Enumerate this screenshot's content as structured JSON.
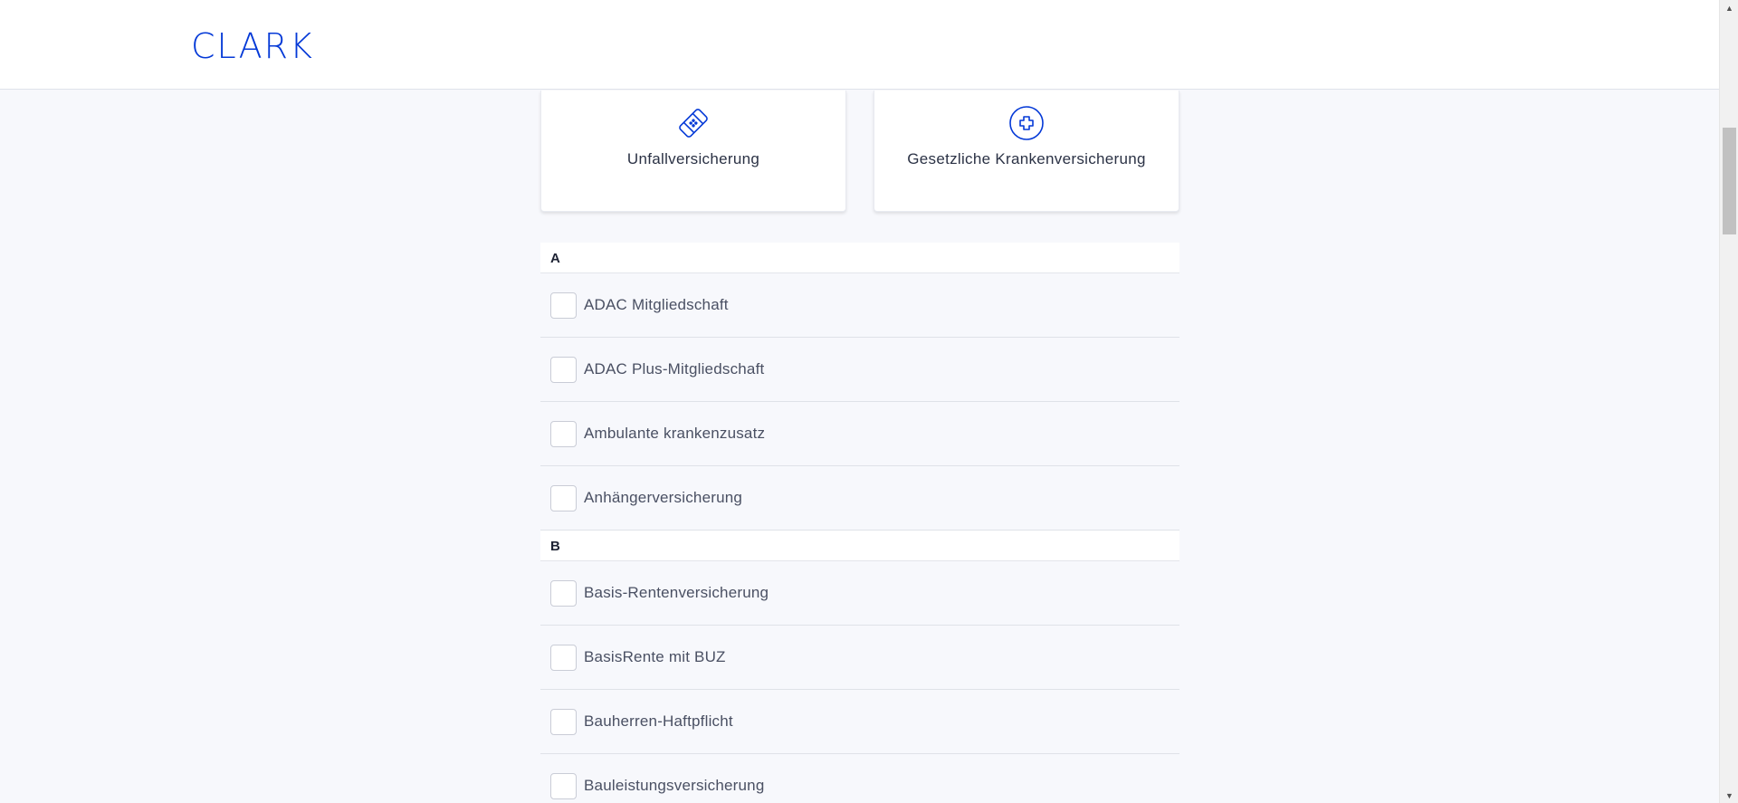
{
  "header": {
    "logo_text": "CLARK",
    "logo_color": "#0439d7"
  },
  "cards": [
    {
      "label": "Unfallversicherung",
      "icon": "bandage-icon"
    },
    {
      "label": "Gesetzliche Krankenversicherung",
      "icon": "medical-cross-icon"
    }
  ],
  "sections": [
    {
      "letter": "A",
      "items": [
        "ADAC Mitgliedschaft",
        "ADAC Plus-Mitgliedschaft",
        "Ambulante krankenzusatz",
        "Anhängerversicherung"
      ]
    },
    {
      "letter": "B",
      "items": [
        "Basis-Rentenversicherung",
        "BasisRente mit BUZ",
        "Bauherren-Haftpflicht",
        "Bauleistungsversicherung"
      ]
    }
  ],
  "colors": {
    "accent": "#0439d7",
    "background": "#f7f8fc"
  }
}
